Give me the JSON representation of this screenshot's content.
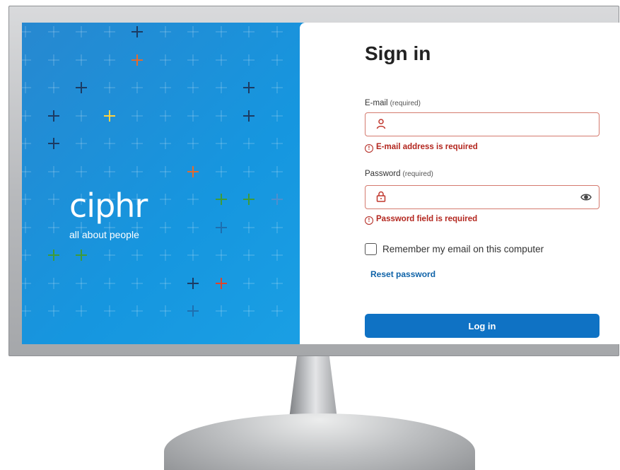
{
  "brand": {
    "logo_text": "ciphr",
    "tagline": "all about people",
    "panel_color": "#1696df"
  },
  "form": {
    "title": "Sign in",
    "email": {
      "label": "E-mail",
      "required_note": "(required)",
      "value": "",
      "icon": "user-icon",
      "error": "E-mail address is required"
    },
    "password": {
      "label": "Password",
      "required_note": "(required)",
      "value": "",
      "icon": "lock-icon",
      "toggle_icon": "eye-icon",
      "error": "Password field is required"
    },
    "remember_label": "Remember my email on this computer",
    "remember_checked": false,
    "reset_link": "Reset password",
    "login_label": "Log in"
  },
  "colors": {
    "accent": "#0f72c4",
    "error": "#b3261e",
    "link": "#0f63a8"
  }
}
